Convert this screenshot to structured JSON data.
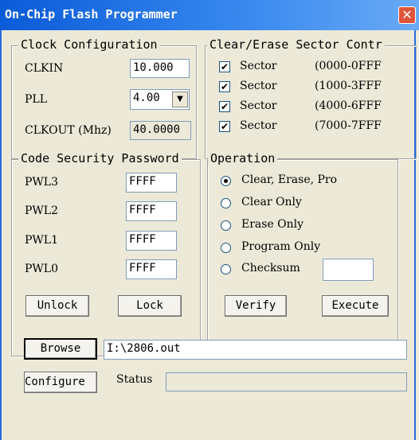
{
  "window": {
    "title": "On-Chip Flash Programmer",
    "close_glyph": "✕"
  },
  "clock": {
    "legend": "Clock Configuration",
    "clkin_label": "CLKIN",
    "clkin_value": "10.000",
    "pll_label": "PLL",
    "pll_value": "4.00",
    "clkout_label": "CLKOUT (Mhz)",
    "clkout_value": "40.0000"
  },
  "sectors": {
    "legend": "Clear/Erase Sector Contr",
    "items": [
      {
        "label": "Sector",
        "range": "(0000-0FFF",
        "checked": true
      },
      {
        "label": "Sector",
        "range": "(1000-3FFF",
        "checked": true
      },
      {
        "label": "Sector",
        "range": "(4000-6FFF",
        "checked": true
      },
      {
        "label": "Sector",
        "range": "(7000-7FFF",
        "checked": true
      }
    ]
  },
  "security": {
    "legend": "Code Security Password",
    "rows": [
      {
        "label": "PWL3",
        "value": "FFFF"
      },
      {
        "label": "PWL2",
        "value": "FFFF"
      },
      {
        "label": "PWL1",
        "value": "FFFF"
      },
      {
        "label": "PWL0",
        "value": "FFFF"
      }
    ],
    "unlock_label": "Unlock",
    "lock_label": "Lock"
  },
  "operation": {
    "legend": "Operation",
    "options": [
      {
        "label": "Clear, Erase, Pro",
        "selected": true
      },
      {
        "label": "Clear Only",
        "selected": false
      },
      {
        "label": "Erase Only",
        "selected": false
      },
      {
        "label": "Program Only",
        "selected": false
      },
      {
        "label": "Checksum",
        "selected": false
      }
    ],
    "checksum_value": "",
    "verify_label": "Verify",
    "execute_label": "Execute"
  },
  "file": {
    "browse_label": "Browse",
    "path": "I:\\2806.out"
  },
  "bottom": {
    "configure_label": "Configure",
    "status_label": "Status",
    "status_value": ""
  },
  "icons": {
    "check": "check-icon",
    "dropdown": "chevron-down-icon",
    "close": "close-icon"
  }
}
